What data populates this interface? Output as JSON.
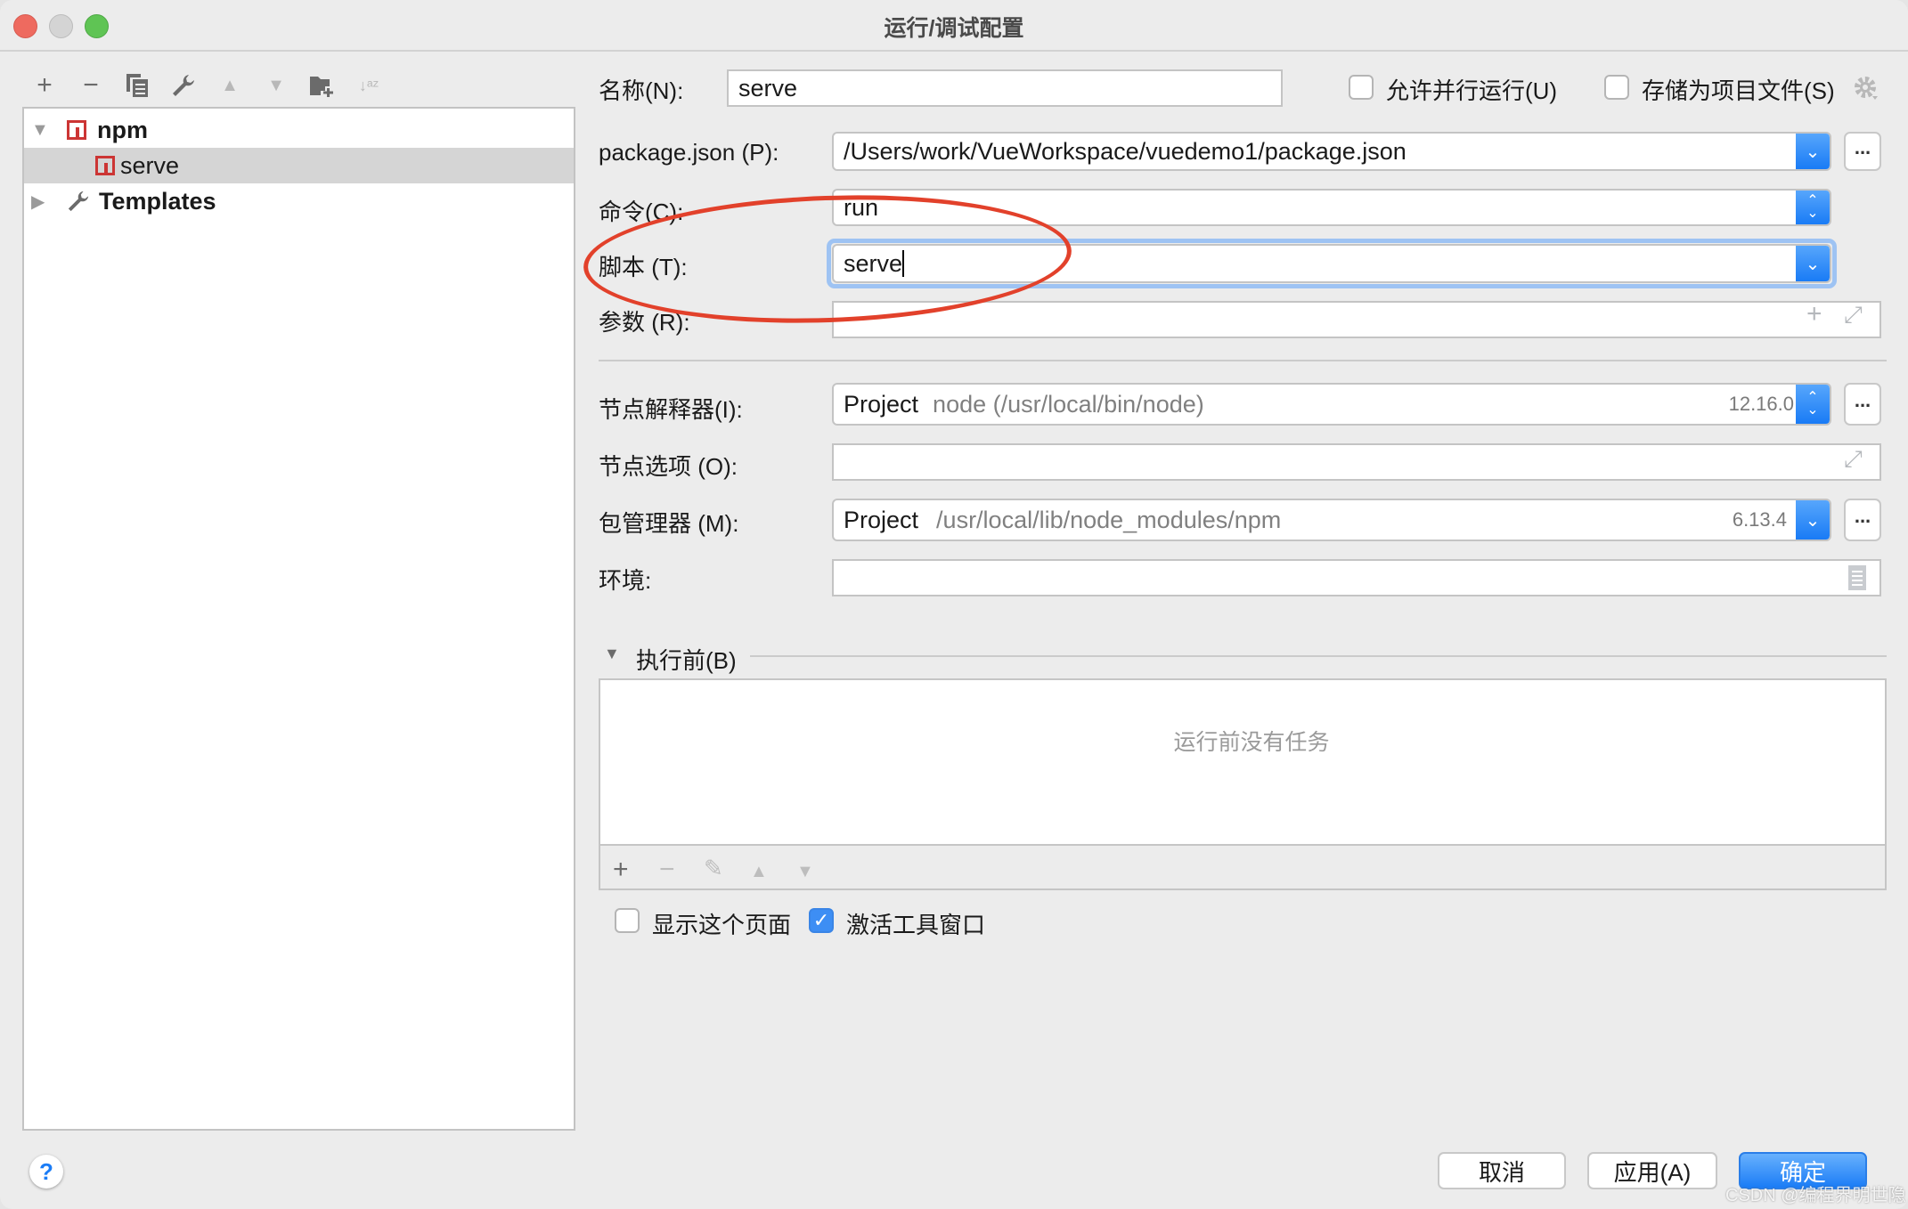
{
  "window": {
    "title": "运行/调试配置"
  },
  "toolbar": {
    "icons": [
      "add-icon",
      "remove-icon",
      "copy-icon",
      "wrench-icon",
      "move-up-icon",
      "move-down-icon",
      "new-folder-icon",
      "sort-icon"
    ]
  },
  "tree": {
    "items": [
      {
        "label": "npm",
        "expanded": true,
        "bold": true
      },
      {
        "label": "serve",
        "selected": true
      },
      {
        "label": "Templates",
        "expanded": false,
        "bold": true
      }
    ]
  },
  "form": {
    "name_label": "名称(N):",
    "name_value": "serve",
    "allow_parallel_label": "允许并行运行(U)",
    "allow_parallel_checked": false,
    "store_as_project_label": "存储为项目文件(S)",
    "store_as_project_checked": false,
    "package_json_label": "package.json (P):",
    "package_json_value": "/Users/work/VueWorkspace/vuedemo1/package.json",
    "command_label": "命令(C):",
    "command_value": "run",
    "script_label": "脚本 (T):",
    "script_value": "serve",
    "args_label": "参数 (R):",
    "args_value": "",
    "node_interpreter_label": "节点解释器(I):",
    "node_interpreter_prefix": "Project",
    "node_interpreter_value": "node (/usr/local/bin/node)",
    "node_interpreter_version": "12.16.0",
    "node_options_label": "节点选项 (O):",
    "node_options_value": "",
    "package_manager_label": "包管理器 (M):",
    "package_manager_prefix": "Project",
    "package_manager_value": "/usr/local/lib/node_modules/npm",
    "package_manager_version": "6.13.4",
    "env_label": "环境:",
    "env_value": "",
    "browse_label": "...",
    "gear_icon": "gear-icon"
  },
  "before_launch": {
    "title": "执行前(B)",
    "empty_text": "运行前没有任务",
    "toolbar_icons": [
      "add-icon",
      "remove-icon",
      "edit-icon",
      "move-up-icon",
      "move-down-icon"
    ]
  },
  "options": {
    "show_page_label": "显示这个页面",
    "show_page_checked": false,
    "activate_tool_window_label": "激活工具窗口",
    "activate_tool_window_checked": true
  },
  "buttons": {
    "cancel": "取消",
    "apply": "应用(A)",
    "ok": "确定",
    "help": "?"
  },
  "watermark": "CSDN @编程界明世隐",
  "colors": {
    "accent": "#1a7cf6",
    "npm_red": "#cc3534",
    "annotation_red": "#e2412b"
  }
}
